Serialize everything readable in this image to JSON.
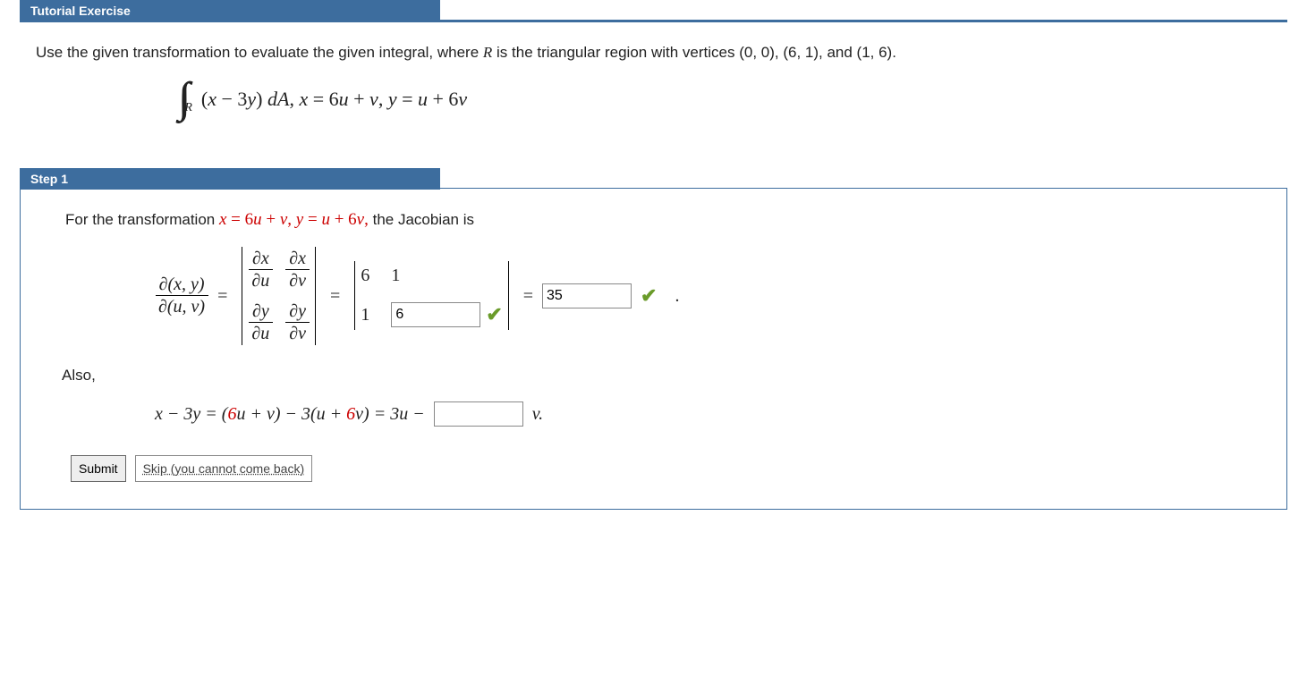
{
  "tutorial": {
    "title": "Tutorial Exercise",
    "prompt_a": "Use the given transformation to evaluate the given integral, where ",
    "prompt_r": "R",
    "prompt_b": " is the triangular region with vertices (0, 0), (6, 1), and (1, 6).",
    "integral_region": "R",
    "integrand_a": "(",
    "integrand_x": "x",
    "integrand_b": " − 3",
    "integrand_y": "y",
    "integrand_c": ") ",
    "integrand_dA": "dA",
    "comma": ", ",
    "xdef_lhs": "x",
    "xdef_eq": " = 6",
    "xdef_u": "u",
    "xdef_plus": " + ",
    "xdef_v": "v",
    "ydef_lhs": "y",
    "ydef_eq": " = ",
    "ydef_u": "u",
    "ydef_plus6": " + 6",
    "ydef_v": "v"
  },
  "step1": {
    "title": "Step 1",
    "line1_a": "For the transformation  ",
    "line1_xdef": "x = 6u + v, y = u + 6v,",
    "line1_b": "  the Jacobian is",
    "jac_top": "∂(x, y)",
    "jac_bot": "∂(u, v)",
    "eq": " = ",
    "dxdu_t": "∂x",
    "dxdu_b": "∂u",
    "dxdv_t": "∂x",
    "dxdv_b": "∂v",
    "dydu_t": "∂y",
    "dydu_b": "∂u",
    "dydv_t": "∂y",
    "dydv_b": "∂v",
    "m11": "6",
    "m12": "1",
    "m21": "1",
    "answer_m22": "6",
    "answer_det": "35",
    "period": ".",
    "also": "Also,",
    "line3_a": "x − 3y = (6u + v) − 3(u + 6v) = 3u − ",
    "line3_end": "v.",
    "submit": "Submit",
    "skip": "Skip (you cannot come back)"
  },
  "chart_data": {
    "type": "table",
    "title": "Jacobian matrix entries",
    "rows": [
      [
        "∂x/∂u",
        6
      ],
      [
        "∂x/∂v",
        1
      ],
      [
        "∂y/∂u",
        1
      ],
      [
        "∂y/∂v",
        6
      ]
    ],
    "determinant": 35
  }
}
